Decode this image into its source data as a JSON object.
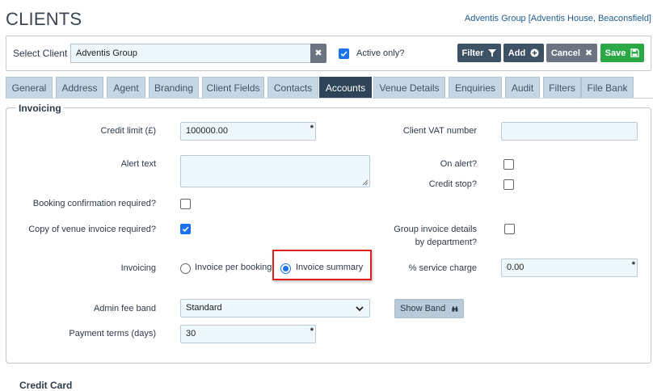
{
  "header": {
    "title": "CLIENTS",
    "current_client": "Adventis Group [Adventis House, Beaconsfield]"
  },
  "client_bar": {
    "select_label": "Select Client",
    "client_value": "Adventis Group",
    "active_only_label": "Active only?",
    "active_only_checked": true,
    "buttons": {
      "filter": "Filter",
      "add": "Add",
      "cancel": "Cancel",
      "save": "Save"
    }
  },
  "tabs": [
    {
      "label": "General",
      "active": false
    },
    {
      "label": "Address",
      "active": false
    },
    {
      "label": "Agent",
      "active": false
    },
    {
      "label": "Branding",
      "active": false
    },
    {
      "label": "Client Fields",
      "active": false
    },
    {
      "label": "Contacts",
      "active": false
    },
    {
      "label": "Accounts",
      "active": true
    },
    {
      "label": "Venue Details",
      "active": false
    },
    {
      "label": "Enquiries",
      "active": false
    },
    {
      "label": "Audit",
      "active": false
    },
    {
      "label": "Filters",
      "active": false
    },
    {
      "label": "File Bank",
      "active": false
    }
  ],
  "invoicing": {
    "legend": "Invoicing",
    "credit_limit_label": "Credit limit (£)",
    "credit_limit_value": "100000.00",
    "client_vat_label": "Client VAT number",
    "client_vat_value": "",
    "alert_text_label": "Alert text",
    "alert_text_value": "",
    "on_alert_label": "On alert?",
    "on_alert_checked": false,
    "credit_stop_label": "Credit stop?",
    "credit_stop_checked": false,
    "booking_conf_label": "Booking confirmation required?",
    "booking_conf_checked": false,
    "copy_venue_invoice_label": "Copy of venue invoice required?",
    "copy_venue_invoice_checked": true,
    "group_invoice_label_1": "Group invoice details",
    "group_invoice_label_2": "by department?",
    "group_invoice_checked": false,
    "invoicing_label": "Invoicing",
    "invoicing_options": [
      "Invoice per booking",
      "Invoice summary"
    ],
    "invoicing_selected": "Invoice summary",
    "service_charge_label": "% service charge",
    "service_charge_value": "0.00",
    "admin_fee_label": "Admin fee band",
    "admin_fee_value": "Standard",
    "show_band_label": "Show Band",
    "payment_terms_label": "Payment terms (days)",
    "payment_terms_value": "30",
    "required_marker": "*"
  },
  "next_section": "Credit Card",
  "icons": {
    "clear": "close-icon",
    "filter": "filter-icon",
    "add": "plus-circle-icon",
    "cancel": "close-icon",
    "save": "floppy-disk-icon",
    "show_band": "binoculars-icon",
    "select": "chevron-down-icon"
  },
  "colors": {
    "accent_blue": "#1a73e8",
    "tab_active": "#2f4459",
    "tab_inactive": "#c5d6e4",
    "save_green": "#29a845",
    "highlight_red": "#e02020",
    "input_bg": "#eef7fb"
  }
}
